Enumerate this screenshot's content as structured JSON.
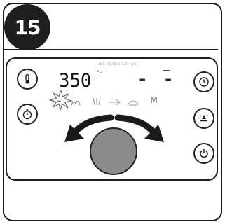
{
  "step": {
    "number": "15"
  },
  "display": {
    "brand": "Sc.harbe series",
    "temperature": "350",
    "temperature_unit": "°F",
    "secondary_readout": "- -",
    "modes": [
      "sear",
      "bake",
      "grill",
      "roast",
      "smoke",
      "M"
    ],
    "mode_m_label": "M"
  },
  "buttons": {
    "left": [
      "thermometer-icon",
      "timer-icon"
    ],
    "right": [
      "clock-icon",
      "fan-icon",
      "power-icon"
    ]
  },
  "colors": {
    "knob": "#8c8c8c",
    "outline": "#1e1e1e",
    "badge": "#1e1e1e"
  }
}
